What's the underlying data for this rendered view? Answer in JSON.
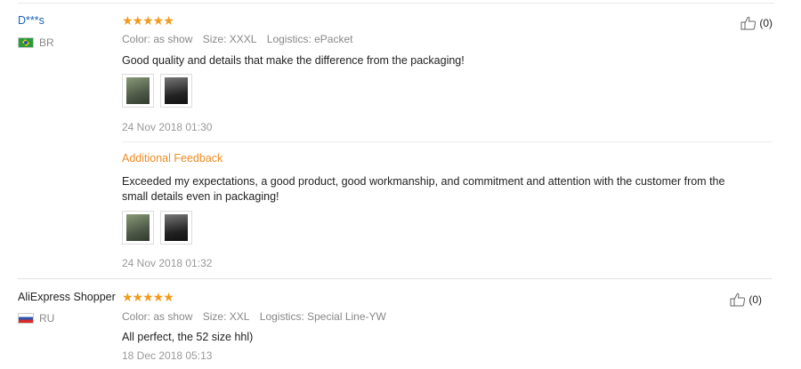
{
  "reviews": [
    {
      "user": "D***s",
      "country": "BR",
      "stars": "★★★★★",
      "meta": {
        "color": "Color: as show",
        "size": "Size: XXXL",
        "logistics": "Logistics: ePacket"
      },
      "text": "Good quality and details that make the difference from the packaging!",
      "date": "24 Nov 2018 01:30",
      "additional_label": "Additional Feedback",
      "additional_text": "Exceeded my expectations, a good product, good workmanship, and commitment and attention with the customer from the small details even in packaging!",
      "additional_date": "24 Nov 2018 01:32",
      "likes": "(0)"
    },
    {
      "user": "AliExpress Shopper",
      "country": "RU",
      "stars": "★★★★★",
      "meta": {
        "color": "Color: as show",
        "size": "Size: XXL",
        "logistics": "Logistics: Special Line-YW"
      },
      "text": "All perfect, the 52 size hhl)",
      "date": "18 Dec 2018 05:13",
      "likes": "(0)"
    }
  ],
  "colors": {
    "stars": "#f39a1d",
    "user_link": "#1b63b8",
    "additional": "#f08c24"
  },
  "icons": [
    "thumbs-up-icon",
    "flag-br-icon",
    "flag-ru-icon"
  ]
}
